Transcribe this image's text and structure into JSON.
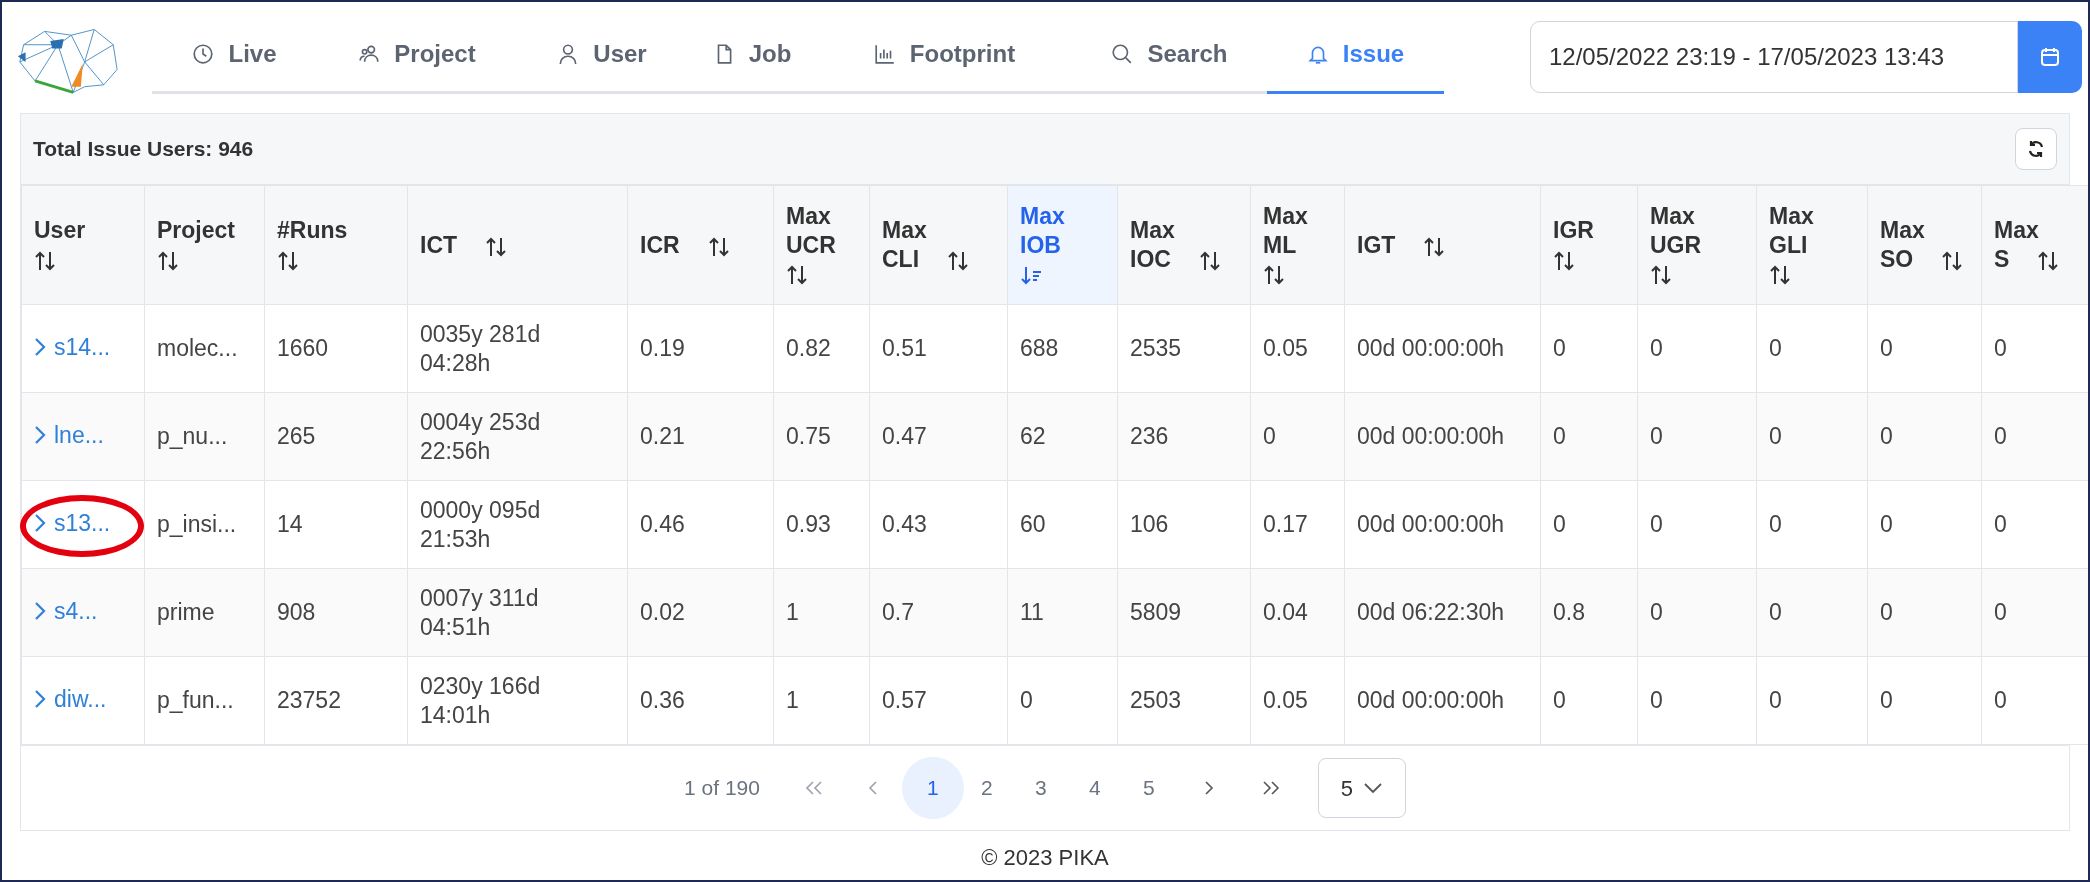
{
  "nav": {
    "tabs": [
      {
        "label": "Live",
        "selected": false
      },
      {
        "label": "Project",
        "selected": false
      },
      {
        "label": "User",
        "selected": false
      },
      {
        "label": "Job",
        "selected": false
      },
      {
        "label": "Footprint",
        "selected": false
      },
      {
        "label": "Search",
        "selected": false
      },
      {
        "label": "Issue",
        "selected": true
      }
    ],
    "date_range": {
      "value": "12/05/2022 23:19 - 17/05/2023 13:43"
    }
  },
  "card": {
    "title": "Total Issue Users: 946",
    "table": {
      "columns": [
        {
          "label": "User",
          "sorted": false
        },
        {
          "label": "Project",
          "sorted": false
        },
        {
          "label": "#Runs",
          "sorted": false
        },
        {
          "label": "ICT",
          "sorted": false
        },
        {
          "label": "ICR",
          "sorted": false
        },
        {
          "label": "Max UCR",
          "sorted": false
        },
        {
          "label": "Max CLI",
          "sorted": false
        },
        {
          "label": "Max IOB",
          "sorted": true
        },
        {
          "label": "Max IOC",
          "sorted": false
        },
        {
          "label": "Max ML",
          "sorted": false
        },
        {
          "label": "IGT",
          "sorted": false
        },
        {
          "label": "IGR",
          "sorted": false
        },
        {
          "label": "Max UGR",
          "sorted": false
        },
        {
          "label": "Max GLI",
          "sorted": false
        },
        {
          "label": "Max SO",
          "sorted": false
        },
        {
          "label": "Max S",
          "sorted": false
        }
      ],
      "rows": [
        {
          "circled": false,
          "cells": [
            "s14...",
            "molec...",
            "1660",
            "0035y 281d 04:28h",
            "0.19",
            "0.82",
            "0.51",
            "688",
            "2535",
            "0.05",
            "00d 00:00:00h",
            "0",
            "0",
            "0",
            "0",
            "0"
          ]
        },
        {
          "circled": false,
          "cells": [
            "lne...",
            "p_nu...",
            "265",
            "0004y 253d 22:56h",
            "0.21",
            "0.75",
            "0.47",
            "62",
            "236",
            "0",
            "00d 00:00:00h",
            "0",
            "0",
            "0",
            "0",
            "0"
          ]
        },
        {
          "circled": true,
          "cells": [
            "s13...",
            "p_insi...",
            "14",
            "0000y 095d 21:53h",
            "0.46",
            "0.93",
            "0.43",
            "60",
            "106",
            "0.17",
            "00d 00:00:00h",
            "0",
            "0",
            "0",
            "0",
            "0"
          ]
        },
        {
          "circled": false,
          "cells": [
            "s4...",
            "prime",
            "908",
            "0007y 311d 04:51h",
            "0.02",
            "1",
            "0.7",
            "11",
            "5809",
            "0.04",
            "00d 06:22:30h",
            "0.8",
            "0",
            "0",
            "0",
            "0"
          ]
        },
        {
          "circled": false,
          "cells": [
            "diw...",
            "p_fun...",
            "23752",
            "0230y 166d 14:01h",
            "0.36",
            "1",
            "0.57",
            "0",
            "2503",
            "0.05",
            "00d 00:00:00h",
            "0",
            "0",
            "0",
            "0",
            "0"
          ]
        }
      ]
    },
    "pagination": {
      "summary": "1 of 190",
      "pages": [
        {
          "label": "1",
          "selected": true
        },
        {
          "label": "2",
          "selected": false
        },
        {
          "label": "3",
          "selected": false
        },
        {
          "label": "4",
          "selected": false
        },
        {
          "label": "5",
          "selected": false
        }
      ],
      "page_size": "5"
    }
  },
  "footer": "© 2023 PIKA"
}
